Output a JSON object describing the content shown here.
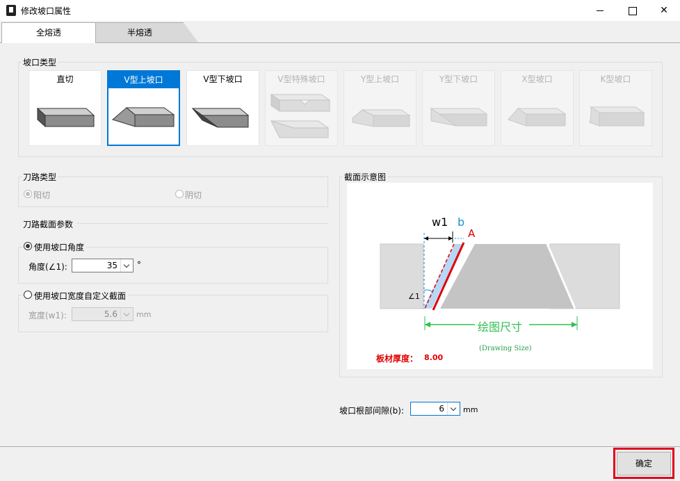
{
  "window": {
    "title": "修改坡口属性",
    "icons": {
      "app": "app-icon",
      "min": "minimize-icon",
      "max": "maximize-icon",
      "close": "close-icon"
    }
  },
  "tabs": [
    {
      "label": "全熔透",
      "active": true
    },
    {
      "label": "半熔透",
      "active": false
    }
  ],
  "bevel_type": {
    "group_label": "坡口类型",
    "items": [
      {
        "label": "直切",
        "state": "enabled"
      },
      {
        "label": "V型上坡口",
        "state": "selected"
      },
      {
        "label": "V型下坡口",
        "state": "enabled"
      },
      {
        "label": "V型特殊坡口",
        "state": "disabled"
      },
      {
        "label": "Y型上坡口",
        "state": "disabled"
      },
      {
        "label": "Y型下坡口",
        "state": "disabled"
      },
      {
        "label": "X型坡口",
        "state": "disabled"
      },
      {
        "label": "K型坡口",
        "state": "disabled"
      }
    ]
  },
  "tool_path": {
    "group_label": "刀路类型",
    "yang_label": "阳切",
    "yin_label": "阴切"
  },
  "section_params": {
    "group_label": "刀路截面参数",
    "use_angle_label": "使用坡口角度",
    "angle_label": "角度(∠1):",
    "angle_value": "35",
    "angle_unit": "°",
    "use_width_label": "使用坡口宽度自定义截面",
    "width_label": "宽度(w1):",
    "width_value": "5.6",
    "width_unit": "mm"
  },
  "diagram": {
    "group_label": "截面示意图",
    "w1": "w1",
    "b": "b",
    "a": "A",
    "angle": "∠1",
    "drawing_size": "绘图尺寸",
    "drawing_size_en": "(Drawing Size)",
    "thickness_label": "板材厚度：",
    "thickness_value": "8.00",
    "colors": {
      "cut": "#e00000",
      "dim": "#1a8fd6",
      "green": "#2fbf4f"
    }
  },
  "root_gap": {
    "label": "坡口根部间隙(b):",
    "value": "6",
    "unit": "mm"
  },
  "ok_label": "确定"
}
